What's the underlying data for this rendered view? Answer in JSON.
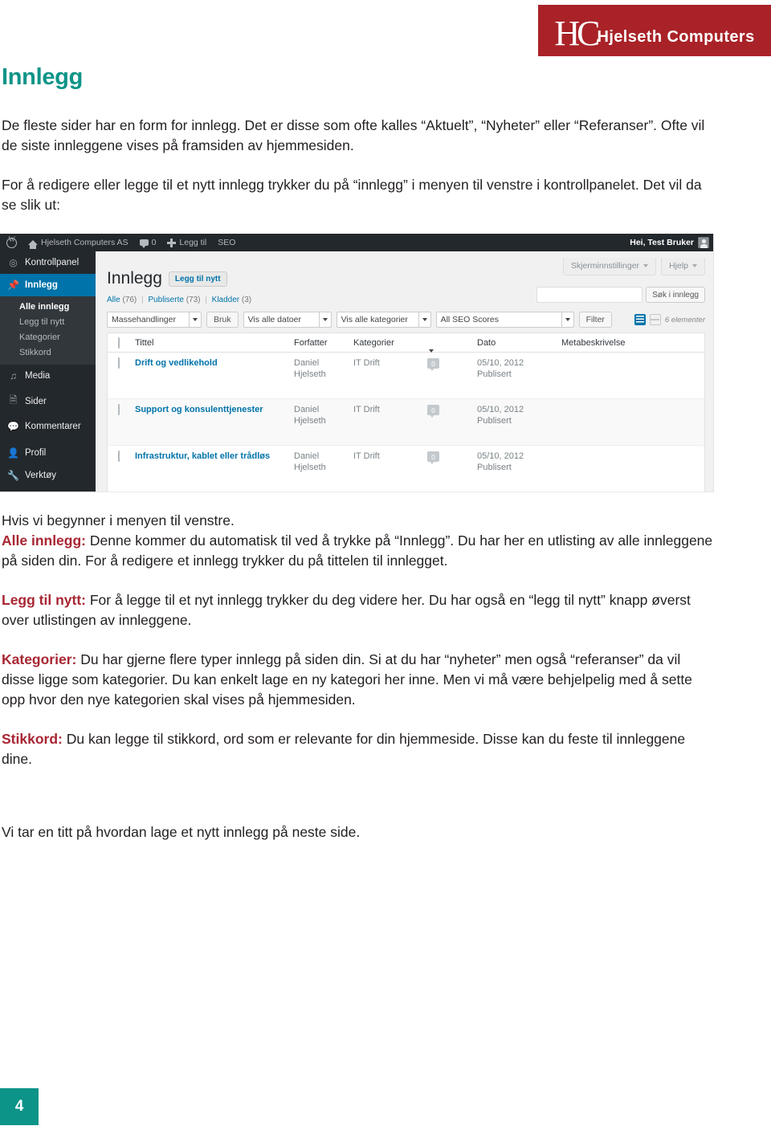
{
  "brand": {
    "monogram": "HC",
    "name": "Hjelseth Computers",
    "bar_color": "#a92228"
  },
  "page": {
    "title": "Innlegg",
    "title_color": "#0d9488",
    "number": "4",
    "number_box_color": "#0d9488",
    "accent_red": "#a82633"
  },
  "intro": {
    "p1": "De fleste sider har en form for innlegg. Det er disse som ofte kalles “Aktuelt”, “Nyheter” eller “Referanser”. Ofte vil de siste innleggene vises på framsiden av hjemmesiden.",
    "p2": "For å redigere eller legge til et nytt innlegg trykker du på “innlegg” i menyen til venstre i kontrollpanelet. Det vil da se slik ut:"
  },
  "after": {
    "p0": "Hvis vi begynner i menyen til venstre.",
    "p1_lead": "Alle innlegg:",
    "p1": " Denne kommer du automatisk til ved å trykke på “Innlegg”. Du har her en utlisting av alle innleggene på siden din. For å redigere et innlegg trykker du på tittelen til innlegget.",
    "p2_lead": "Legg til nytt:",
    "p2": " For å legge til et nyt innlegg trykker du deg videre her. Du har også en “legg til nytt” knapp øverst over utlistingen av innleggene.",
    "p3_lead": "Kategorier:",
    "p3": " Du har gjerne flere typer innlegg på siden din. Si at du har “nyheter” men også “referanser” da vil disse ligge som kategorier. Du kan enkelt lage en ny kategori her inne. Men vi må være behjelpelig med å sette opp hvor den nye kategorien skal vises på hjemmesiden.",
    "p4_lead": "Stikkord:",
    "p4": " Du kan legge til stikkord, ord som er relevante for din hjemmeside. Disse kan du feste til innleggene dine."
  },
  "closing": {
    "p1": "Vi tar en titt på hvordan lage et nytt innlegg på neste side."
  },
  "wp": {
    "adminbar": {
      "wp_icon": "wordpress-icon",
      "site_name": "Hjelseth Computers AS",
      "comment_icon": "comment-bubble-icon",
      "comment_count": "0",
      "new_icon": "plus-icon",
      "new_label": "Legg til",
      "seo_label": "SEO",
      "greeting": "Hei, Test Bruker",
      "avatar": "user-avatar-icon"
    },
    "menu": [
      {
        "label": "Kontrollpanel",
        "icon": "dashboard-icon",
        "active": false
      },
      {
        "label": "Innlegg",
        "icon": "pin-icon",
        "active": true
      },
      {
        "label": "Media",
        "icon": "media-icon",
        "active": false
      },
      {
        "label": "Sider",
        "icon": "pages-icon",
        "active": false
      },
      {
        "label": "Kommentarer",
        "icon": "comments-icon",
        "active": false
      },
      {
        "label": "Profil",
        "icon": "user-icon",
        "active": false
      },
      {
        "label": "Verktøy",
        "icon": "wrench-icon",
        "active": false
      }
    ],
    "submenu": [
      {
        "label": "Alle innlegg",
        "current": true
      },
      {
        "label": "Legg til nytt",
        "current": false
      },
      {
        "label": "Kategorier",
        "current": false
      },
      {
        "label": "Stikkord",
        "current": false
      }
    ],
    "screen_options": "Skjerminnstillinger",
    "help": "Hjelp",
    "heading": "Innlegg",
    "add_new": "Legg til nytt",
    "views": [
      {
        "label": "Alle",
        "count": "(76)"
      },
      {
        "label": "Publiserte",
        "count": "(73)"
      },
      {
        "label": "Kladder",
        "count": "(3)"
      }
    ],
    "search_value": "",
    "search_button": "Søk i innlegg",
    "filters": {
      "bulk_actions": "Massehandlinger",
      "apply": "Bruk",
      "all_dates": "Vis alle datoer",
      "all_categories": "Vis alle kategorier",
      "seo_scores": "All SEO Scores",
      "filter": "Filter"
    },
    "item_count": "6 elementer",
    "columns": {
      "title": "Tittel",
      "author": "Forfatter",
      "categories": "Kategorier",
      "comments_icon": "comment-icon",
      "date": "Dato",
      "meta": "Metabeskrivelse"
    },
    "rows": [
      {
        "title": "Drift og vedlikehold",
        "author_first": "Daniel",
        "author_last": "Hjelseth",
        "category": "IT Drift",
        "comments": "0",
        "date": "05/10, 2012",
        "status": "Publisert",
        "meta": ""
      },
      {
        "title": "Support og konsulenttjenester",
        "author_first": "Daniel",
        "author_last": "Hjelseth",
        "category": "IT Drift",
        "comments": "0",
        "date": "05/10, 2012",
        "status": "Publisert",
        "meta": ""
      },
      {
        "title": "Infrastruktur, kablet eller trådløs",
        "author_first": "Daniel",
        "author_last": "Hjelseth",
        "category": "IT Drift",
        "comments": "0",
        "date": "05/10, 2012",
        "status": "Publisert",
        "meta": ""
      }
    ]
  }
}
